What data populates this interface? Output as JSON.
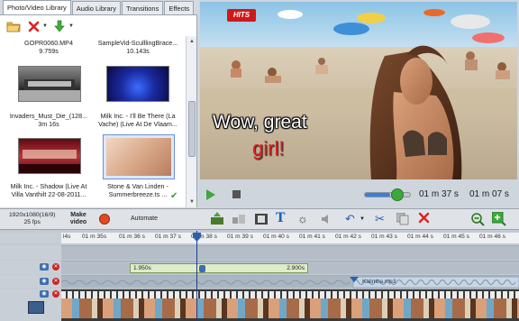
{
  "library": {
    "tabs": [
      "Photo/Video Library",
      "Audio Library",
      "Transitions",
      "Effects"
    ],
    "items": [
      {
        "name": "GOPR0060.MP4",
        "duration": "9.759s"
      },
      {
        "name": "SampleVid-SculllingBrace...",
        "duration": "10.143s"
      },
      {
        "name": "Invaders_Must_Die_(128...",
        "duration": "3m 16s"
      },
      {
        "name": "Milk Inc. - I'll Be There (La Vache) (Live At De Vlaam..."
      },
      {
        "name": "Milk Inc. - Shadow (Live At Villa Vanthilt 22-08-2011..."
      },
      {
        "name": "Stone & Van Linden - Summerbreeze.ts ..."
      }
    ]
  },
  "preview": {
    "hits_logo": "HITS",
    "caption_line1": "Wow, great",
    "caption_line2": "girl!",
    "time_current": "01 m 37 s",
    "time_total": "01 m 07 s"
  },
  "toolbar": {
    "resolution": "1920x1080(16/9)",
    "fps": "25 fps",
    "make_video": "Make video",
    "automate": "Automate"
  },
  "timeline": {
    "ticks": [
      "l4s",
      "01 m 35s",
      "01 m 36 s",
      "01 m 37 s",
      "01 m 38 s",
      "01 m 39 s",
      "01 m 40 s",
      "01 m 41 s",
      "01 m 42 s",
      "01 m 43 s",
      "01 m 44 s",
      "01 m 45 s",
      "01 m 46 s"
    ],
    "text_clip_start": "1.950s",
    "text_clip_end": "2.900s",
    "audio_clip": "Kalimba.mp3"
  }
}
